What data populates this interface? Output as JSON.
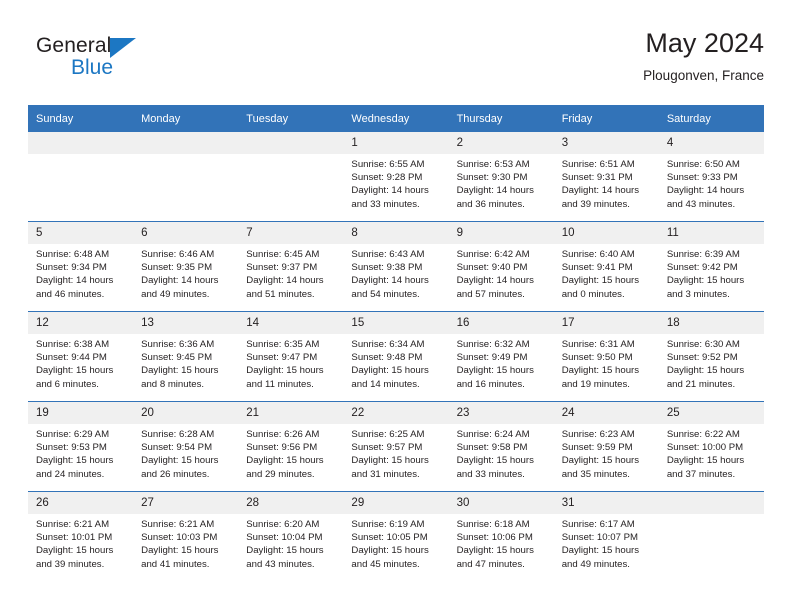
{
  "brand": {
    "name_top": "General",
    "name_bottom": "Blue",
    "triangle_color": "#1c77c3"
  },
  "header": {
    "title": "May 2024",
    "subtitle": "Plougonven, France"
  },
  "theme": {
    "header_blue": "#3273b8",
    "daynum_band": "#f0f0f0",
    "text": "#231f20"
  },
  "calendar": {
    "weekday_headers": [
      "Sunday",
      "Monday",
      "Tuesday",
      "Wednesday",
      "Thursday",
      "Friday",
      "Saturday"
    ],
    "labels": {
      "sunrise": "Sunrise:",
      "sunset": "Sunset:",
      "daylight": "Daylight:"
    },
    "weeks": [
      [
        {
          "day": "",
          "empty": true
        },
        {
          "day": "",
          "empty": true
        },
        {
          "day": "",
          "empty": true
        },
        {
          "day": "1",
          "sunrise": "Sunrise: 6:55 AM",
          "sunset": "Sunset: 9:28 PM",
          "daylight": "Daylight: 14 hours and 33 minutes."
        },
        {
          "day": "2",
          "sunrise": "Sunrise: 6:53 AM",
          "sunset": "Sunset: 9:30 PM",
          "daylight": "Daylight: 14 hours and 36 minutes."
        },
        {
          "day": "3",
          "sunrise": "Sunrise: 6:51 AM",
          "sunset": "Sunset: 9:31 PM",
          "daylight": "Daylight: 14 hours and 39 minutes."
        },
        {
          "day": "4",
          "sunrise": "Sunrise: 6:50 AM",
          "sunset": "Sunset: 9:33 PM",
          "daylight": "Daylight: 14 hours and 43 minutes."
        }
      ],
      [
        {
          "day": "5",
          "sunrise": "Sunrise: 6:48 AM",
          "sunset": "Sunset: 9:34 PM",
          "daylight": "Daylight: 14 hours and 46 minutes."
        },
        {
          "day": "6",
          "sunrise": "Sunrise: 6:46 AM",
          "sunset": "Sunset: 9:35 PM",
          "daylight": "Daylight: 14 hours and 49 minutes."
        },
        {
          "day": "7",
          "sunrise": "Sunrise: 6:45 AM",
          "sunset": "Sunset: 9:37 PM",
          "daylight": "Daylight: 14 hours and 51 minutes."
        },
        {
          "day": "8",
          "sunrise": "Sunrise: 6:43 AM",
          "sunset": "Sunset: 9:38 PM",
          "daylight": "Daylight: 14 hours and 54 minutes."
        },
        {
          "day": "9",
          "sunrise": "Sunrise: 6:42 AM",
          "sunset": "Sunset: 9:40 PM",
          "daylight": "Daylight: 14 hours and 57 minutes."
        },
        {
          "day": "10",
          "sunrise": "Sunrise: 6:40 AM",
          "sunset": "Sunset: 9:41 PM",
          "daylight": "Daylight: 15 hours and 0 minutes."
        },
        {
          "day": "11",
          "sunrise": "Sunrise: 6:39 AM",
          "sunset": "Sunset: 9:42 PM",
          "daylight": "Daylight: 15 hours and 3 minutes."
        }
      ],
      [
        {
          "day": "12",
          "sunrise": "Sunrise: 6:38 AM",
          "sunset": "Sunset: 9:44 PM",
          "daylight": "Daylight: 15 hours and 6 minutes."
        },
        {
          "day": "13",
          "sunrise": "Sunrise: 6:36 AM",
          "sunset": "Sunset: 9:45 PM",
          "daylight": "Daylight: 15 hours and 8 minutes."
        },
        {
          "day": "14",
          "sunrise": "Sunrise: 6:35 AM",
          "sunset": "Sunset: 9:47 PM",
          "daylight": "Daylight: 15 hours and 11 minutes."
        },
        {
          "day": "15",
          "sunrise": "Sunrise: 6:34 AM",
          "sunset": "Sunset: 9:48 PM",
          "daylight": "Daylight: 15 hours and 14 minutes."
        },
        {
          "day": "16",
          "sunrise": "Sunrise: 6:32 AM",
          "sunset": "Sunset: 9:49 PM",
          "daylight": "Daylight: 15 hours and 16 minutes."
        },
        {
          "day": "17",
          "sunrise": "Sunrise: 6:31 AM",
          "sunset": "Sunset: 9:50 PM",
          "daylight": "Daylight: 15 hours and 19 minutes."
        },
        {
          "day": "18",
          "sunrise": "Sunrise: 6:30 AM",
          "sunset": "Sunset: 9:52 PM",
          "daylight": "Daylight: 15 hours and 21 minutes."
        }
      ],
      [
        {
          "day": "19",
          "sunrise": "Sunrise: 6:29 AM",
          "sunset": "Sunset: 9:53 PM",
          "daylight": "Daylight: 15 hours and 24 minutes."
        },
        {
          "day": "20",
          "sunrise": "Sunrise: 6:28 AM",
          "sunset": "Sunset: 9:54 PM",
          "daylight": "Daylight: 15 hours and 26 minutes."
        },
        {
          "day": "21",
          "sunrise": "Sunrise: 6:26 AM",
          "sunset": "Sunset: 9:56 PM",
          "daylight": "Daylight: 15 hours and 29 minutes."
        },
        {
          "day": "22",
          "sunrise": "Sunrise: 6:25 AM",
          "sunset": "Sunset: 9:57 PM",
          "daylight": "Daylight: 15 hours and 31 minutes."
        },
        {
          "day": "23",
          "sunrise": "Sunrise: 6:24 AM",
          "sunset": "Sunset: 9:58 PM",
          "daylight": "Daylight: 15 hours and 33 minutes."
        },
        {
          "day": "24",
          "sunrise": "Sunrise: 6:23 AM",
          "sunset": "Sunset: 9:59 PM",
          "daylight": "Daylight: 15 hours and 35 minutes."
        },
        {
          "day": "25",
          "sunrise": "Sunrise: 6:22 AM",
          "sunset": "Sunset: 10:00 PM",
          "daylight": "Daylight: 15 hours and 37 minutes."
        }
      ],
      [
        {
          "day": "26",
          "sunrise": "Sunrise: 6:21 AM",
          "sunset": "Sunset: 10:01 PM",
          "daylight": "Daylight: 15 hours and 39 minutes."
        },
        {
          "day": "27",
          "sunrise": "Sunrise: 6:21 AM",
          "sunset": "Sunset: 10:03 PM",
          "daylight": "Daylight: 15 hours and 41 minutes."
        },
        {
          "day": "28",
          "sunrise": "Sunrise: 6:20 AM",
          "sunset": "Sunset: 10:04 PM",
          "daylight": "Daylight: 15 hours and 43 minutes."
        },
        {
          "day": "29",
          "sunrise": "Sunrise: 6:19 AM",
          "sunset": "Sunset: 10:05 PM",
          "daylight": "Daylight: 15 hours and 45 minutes."
        },
        {
          "day": "30",
          "sunrise": "Sunrise: 6:18 AM",
          "sunset": "Sunset: 10:06 PM",
          "daylight": "Daylight: 15 hours and 47 minutes."
        },
        {
          "day": "31",
          "sunrise": "Sunrise: 6:17 AM",
          "sunset": "Sunset: 10:07 PM",
          "daylight": "Daylight: 15 hours and 49 minutes."
        },
        {
          "day": "",
          "empty": true
        }
      ]
    ]
  }
}
